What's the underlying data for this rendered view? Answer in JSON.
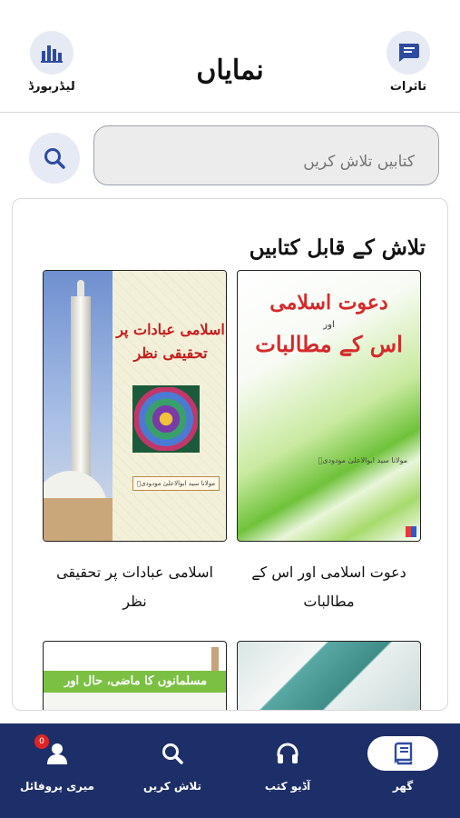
{
  "header": {
    "title": "نمایاں",
    "left_button_label": "لیڈربورڈ",
    "right_button_label": "تاثرات"
  },
  "search": {
    "placeholder": "کتابیں تلاش کریں"
  },
  "section": {
    "title": "تلاش کے قابل کتابیں"
  },
  "books": [
    {
      "title": "دعوت اسلامی اور اس کے مطالبات",
      "cover_line1": "دعوت اسلامی",
      "cover_line2": "اور",
      "cover_line3": "اس کے مطالبات",
      "cover_author": "مولانا سید ابوالاعلیٰ مودودیؒ"
    },
    {
      "title": "اسلامی عبادات پر تحقیقی نظر",
      "cover_line1": "اسلامی عبادات پر",
      "cover_line2": "تحقیقی نظر",
      "cover_author": "مولانا سید ابوالاعلیٰ مودودیؒ"
    },
    {
      "cover_line1": ""
    },
    {
      "cover_line1": "مسلمانوں کا ماضی، حال اور مستقبل"
    }
  ],
  "bottom_nav": {
    "items": [
      {
        "label": "گھر",
        "icon": "book-icon",
        "active": true
      },
      {
        "label": "آڈیو کتب",
        "icon": "headphones-icon",
        "active": false
      },
      {
        "label": "تلاش کریں",
        "icon": "search-icon",
        "active": false
      },
      {
        "label": "میری پروفائل",
        "icon": "profile-icon",
        "active": false,
        "badge": "0"
      }
    ]
  },
  "colors": {
    "nav_background": "#1d2f68",
    "icon_accent": "#2f4ba0",
    "circle_background": "#e6eaf5"
  }
}
